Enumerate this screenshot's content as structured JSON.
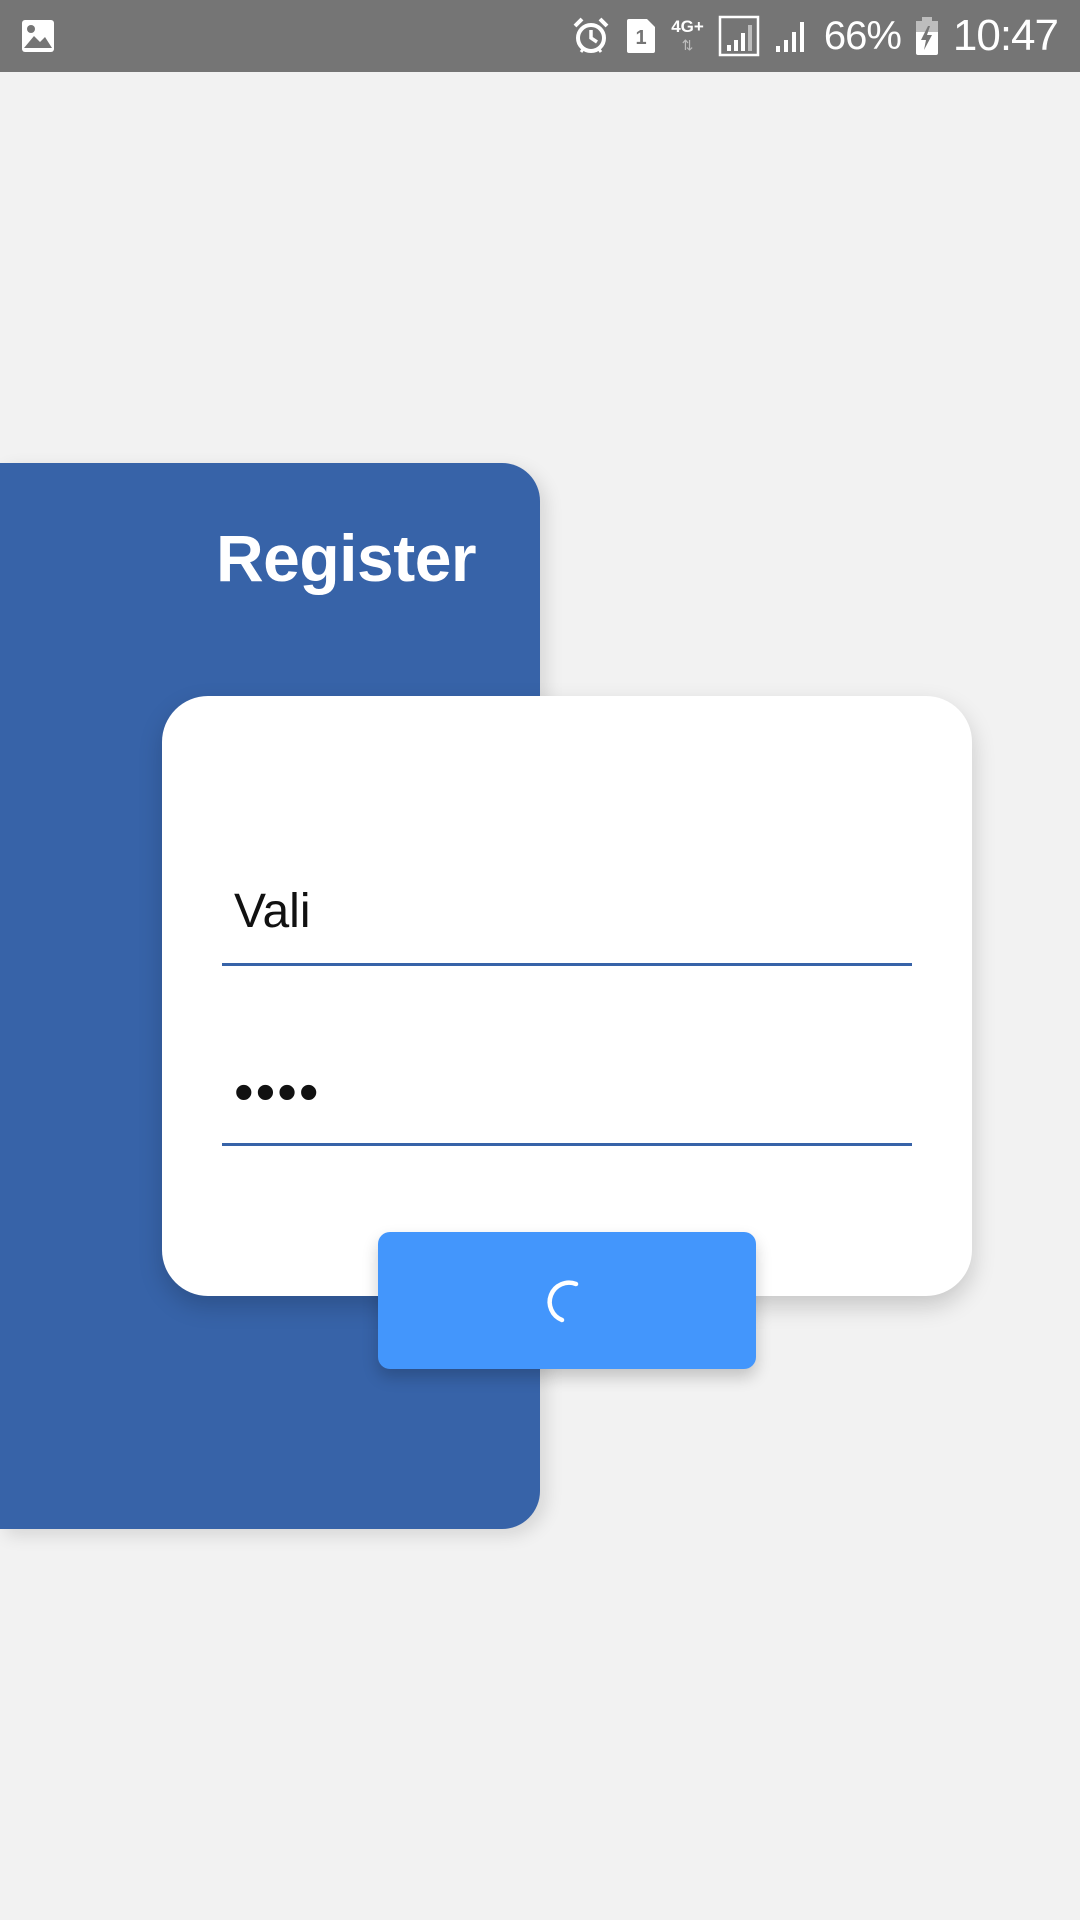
{
  "status_bar": {
    "icons": [
      "gallery-icon",
      "alarm-icon",
      "sim-1-icon",
      "network-4g-plus-icon",
      "signal-sim1-icon",
      "signal-sim2-icon",
      "battery-charging-icon"
    ],
    "network_type": "4G+",
    "network_arrows": "⇅",
    "sim_label": "1",
    "battery_percent": "66%",
    "time": "10:47"
  },
  "panel": {
    "title": "Register"
  },
  "form": {
    "username_value": "Vali",
    "password_value": "••••",
    "submit_state": "loading"
  },
  "colors": {
    "background": "#f2f2f2",
    "status_bar": "#757575",
    "panel_blue": "#3763a8",
    "button_blue": "#4396fc",
    "card": "#ffffff"
  }
}
